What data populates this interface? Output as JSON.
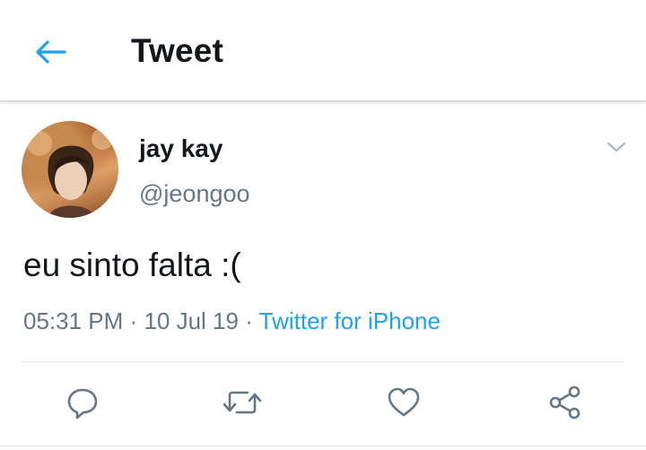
{
  "header": {
    "title": "Tweet",
    "back_icon": "back-arrow-icon"
  },
  "tweet": {
    "author": {
      "display_name": "jay kay",
      "handle": "@jeongoo"
    },
    "text": "eu sinto falta :(",
    "time": "05:31 PM",
    "separator1": "·",
    "date": "10 Jul 19",
    "separator2": "·",
    "source": "Twitter for iPhone",
    "actions": [
      "reply-icon",
      "retweet-icon",
      "like-icon",
      "share-icon"
    ]
  },
  "colors": {
    "accent": "#1da1f2",
    "text_primary": "#14171a",
    "text_secondary": "#657786",
    "icon_gray": "#657786"
  }
}
